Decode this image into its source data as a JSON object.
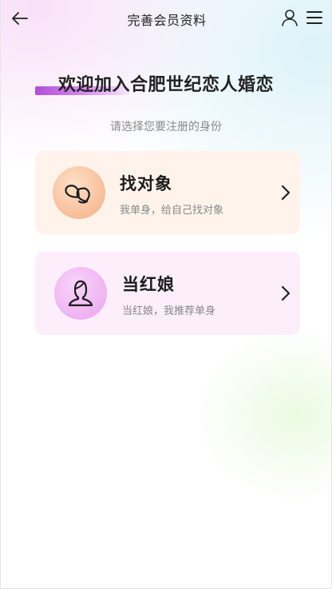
{
  "header": {
    "title": "完善会员资料",
    "back_icon": "arrow-left-icon",
    "user_icon": "user-icon",
    "menu_icon": "menu-icon"
  },
  "welcome": {
    "heading": "欢迎加入合肥世纪恋人婚恋",
    "subtitle": "请选择您要注册的身份"
  },
  "options": [
    {
      "title": "找对象",
      "description": "我单身，给自己找对象",
      "icon": "heart-icon",
      "color": "#fff3ec"
    },
    {
      "title": "当红娘",
      "description": "当红娘，我推荐单身",
      "icon": "person-icon",
      "color": "#fdeefc"
    }
  ],
  "colors": {
    "accent": "#b14fd6"
  }
}
